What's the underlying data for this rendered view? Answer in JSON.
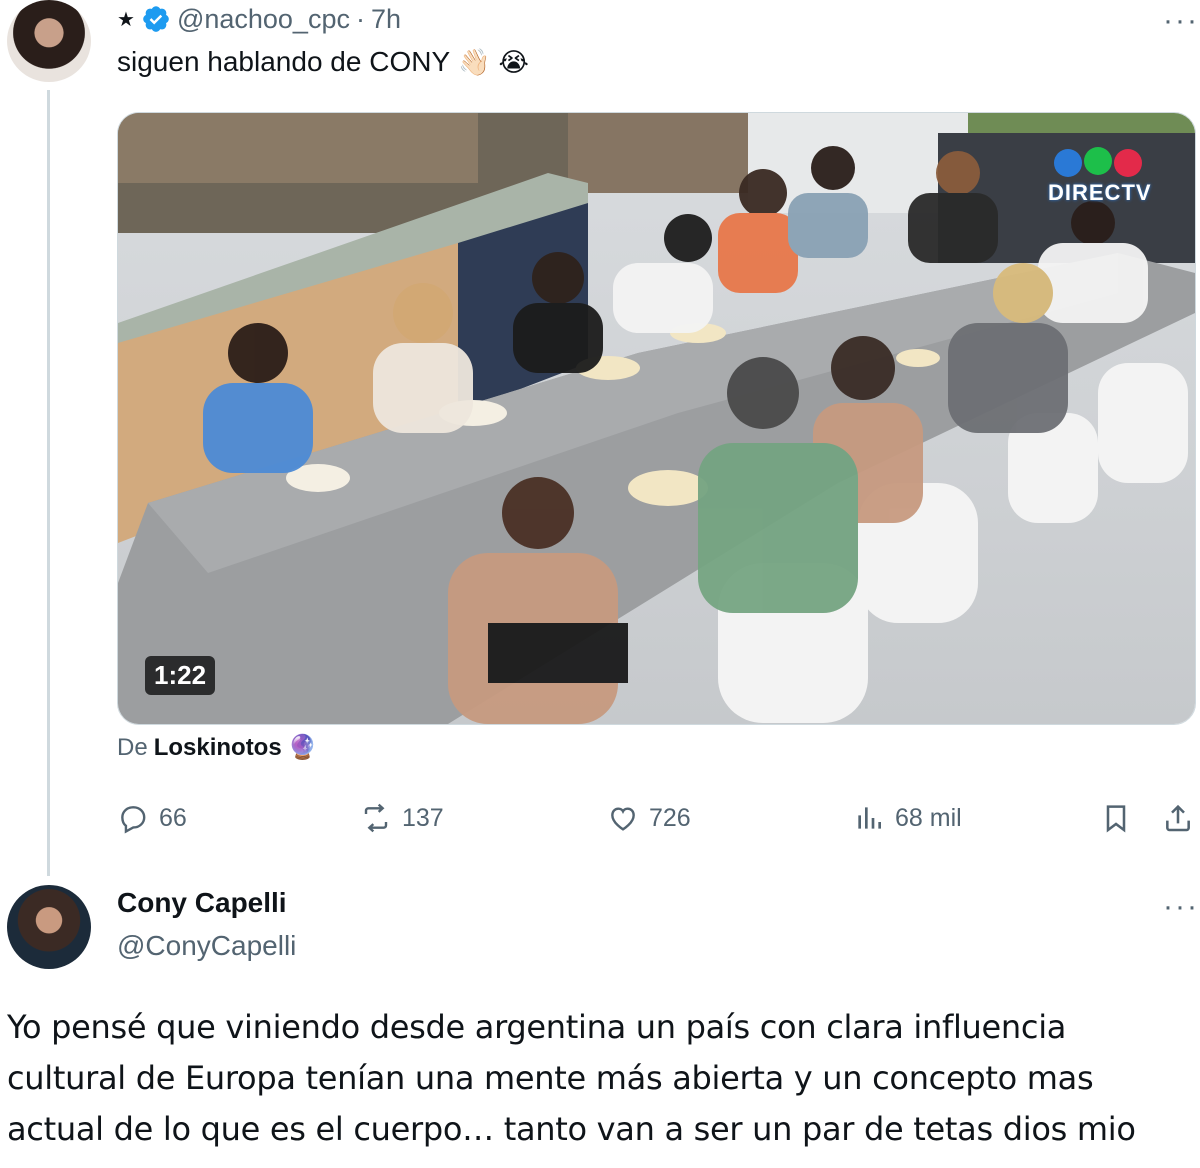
{
  "tweet": {
    "star": "★",
    "handle": "@nachoo_cpc",
    "separator": "·",
    "time": "7h",
    "more": "···",
    "text": "siguen hablando de CONY",
    "emojis": [
      "👋🏻",
      "😭"
    ],
    "video_duration": "1:22",
    "watermark": "DIRECTV",
    "source_prefix": "De",
    "source_name": "Loskinotos",
    "source_emoji": "🔮",
    "stats": {
      "replies": "66",
      "retweets": "137",
      "likes": "726",
      "views": "68 mil"
    }
  },
  "reply": {
    "name": "Cony Capelli",
    "handle": "@ConyCapelli",
    "more": "···",
    "lines": [
      "Yo pensé que viniendo desde argentina un país con clara influencia",
      "cultural de Europa tenían una mente más abierta y un concepto mas",
      "actual de lo que es el cuerpo…  tanto van a ser un par de tetas dios mio"
    ]
  },
  "colors": {
    "verified": "#1d9bf0",
    "muted": "#536471",
    "text": "#0f1419",
    "border": "#cfd9de"
  },
  "icons": [
    "verified-badge-icon",
    "more-icon",
    "reply-icon",
    "retweet-icon",
    "like-icon",
    "views-icon",
    "bookmark-icon",
    "share-icon"
  ]
}
